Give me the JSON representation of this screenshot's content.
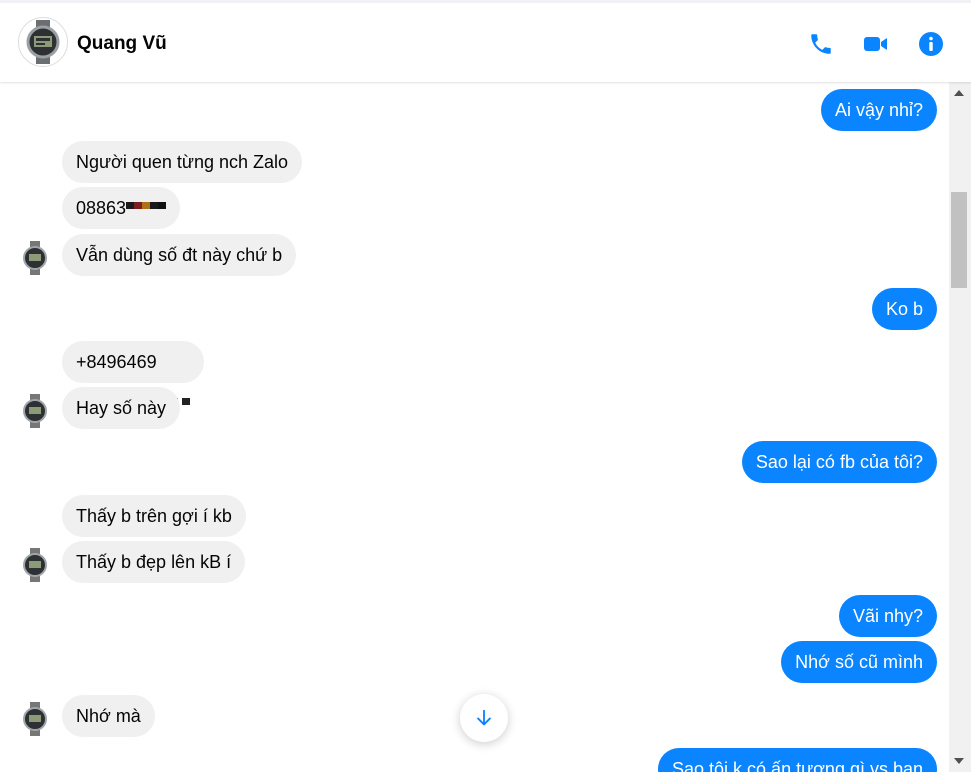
{
  "header": {
    "contact_name": "Quang Vũ",
    "call_icon": "phone-icon",
    "video_icon": "video-camera-icon",
    "info_icon": "info-icon",
    "accent_color": "#0a84ff"
  },
  "messages": [
    {
      "side": "out",
      "text": "Ai vậy nhỉ?"
    },
    {
      "side": "in",
      "text": "Người quen từng nch Zalo"
    },
    {
      "side": "in",
      "text": "08863",
      "redacted": true
    },
    {
      "side": "in",
      "text": "Vẫn dùng số đt này chứ b"
    },
    {
      "side": "out",
      "text": "Ko b"
    },
    {
      "side": "in",
      "text": "+8496469",
      "redacted": true
    },
    {
      "side": "in",
      "text": "Hay số này"
    },
    {
      "side": "out",
      "text": "Sao lại có fb của tôi?"
    },
    {
      "side": "in",
      "text": "Thấy b trên gợi í kb"
    },
    {
      "side": "in",
      "text": "Thấy b đẹp lên kB í"
    },
    {
      "side": "out",
      "text": "Vãi nhy?"
    },
    {
      "side": "out",
      "text": "Nhớ số cũ mình"
    },
    {
      "side": "in",
      "text": "Nhớ mà"
    },
    {
      "side": "out",
      "text": "Sao tôi k có ấn tượng gì vs bạn"
    }
  ],
  "scroll_down_icon": "arrow-down-icon"
}
